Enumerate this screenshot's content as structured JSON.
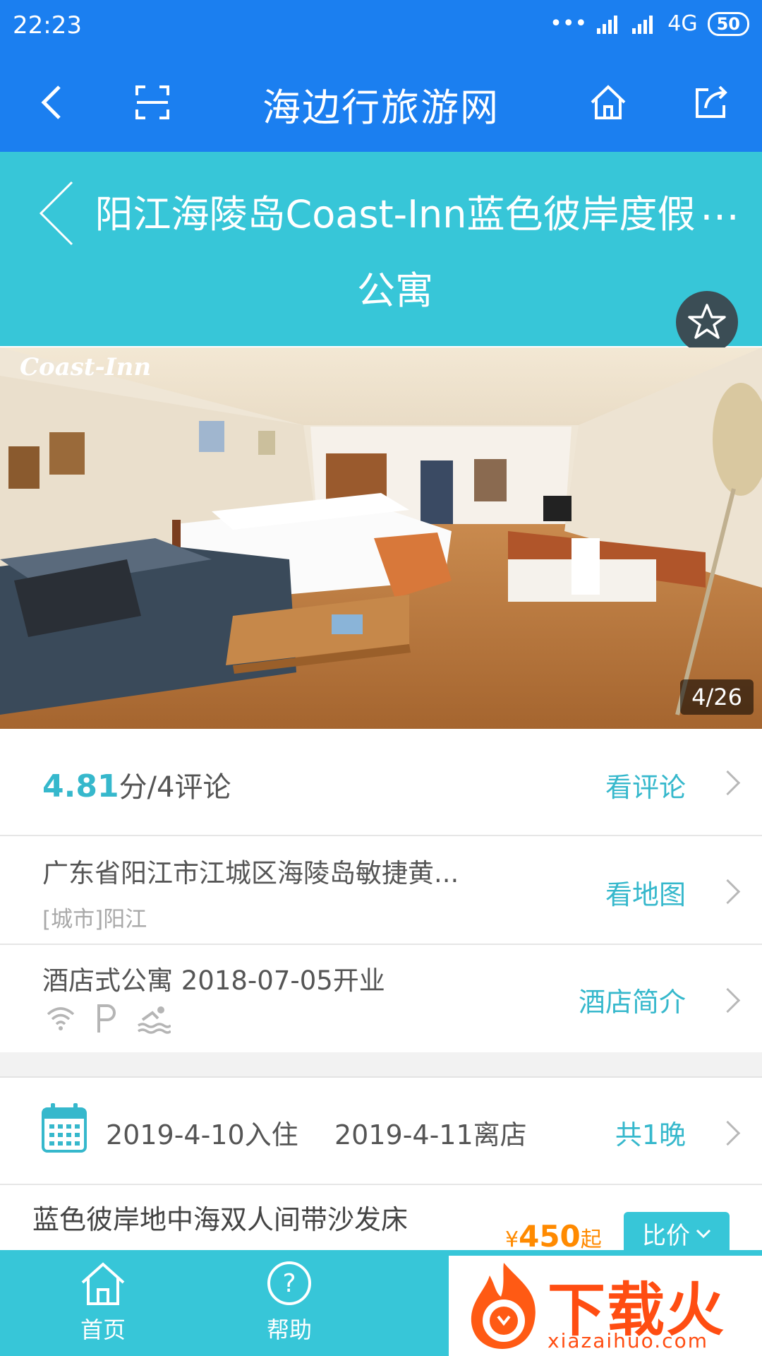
{
  "status": {
    "time": "22:23",
    "network": "4G",
    "battery": "50"
  },
  "nav": {
    "title": "海边行旅游网"
  },
  "hotel": {
    "title": "阳江海陵岛Coast-Inn蓝色彼岸度假公寓",
    "more": "…"
  },
  "photo": {
    "logo": "Coast-Inn",
    "counter": "4/26"
  },
  "rating": {
    "score": "4.81",
    "suffix": "分/4评论",
    "link": "看评论"
  },
  "address": {
    "line": "广东省阳江市江城区海陵岛敏捷黄...",
    "city": "[城市]阳江",
    "link": "看地图"
  },
  "intro": {
    "line": "酒店式公寓 2018-07-05开业",
    "link": "酒店简介",
    "amenities": [
      "wifi-icon",
      "parking-icon",
      "swimming-icon"
    ]
  },
  "dates": {
    "checkin": "2019-4-10入住",
    "checkout": "2019-4-11离店",
    "nights": "共1晚"
  },
  "room": {
    "name": "蓝色彼岸地中海双人间带沙发床",
    "currency": "¥",
    "price": "450",
    "price_suffix": "起",
    "compare": "比价"
  },
  "tabs": [
    {
      "label": "首页"
    },
    {
      "label": "帮助"
    }
  ],
  "watermark": {
    "text": "下载火",
    "url": "xiazaihuo.com"
  },
  "colors": {
    "nav_blue": "#1b7ff0",
    "teal": "#37c6d8",
    "link": "#36b8cc",
    "price": "#ff8a00"
  }
}
